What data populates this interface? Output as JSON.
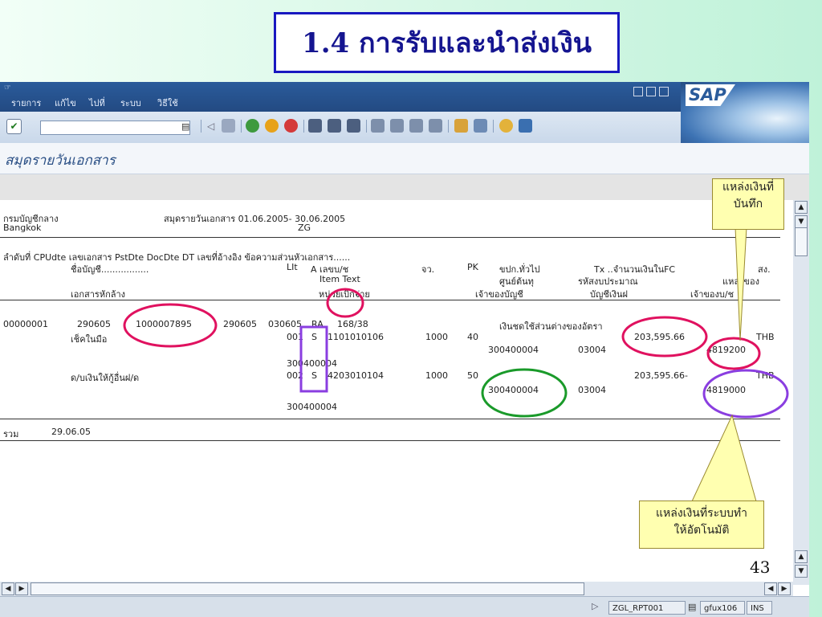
{
  "slide": {
    "title": "1.4 การรับและนำส่งเงิน",
    "page_number": "43"
  },
  "sap": {
    "menu": [
      "รายการ",
      "แก้ไข",
      "ไปที่",
      "ระบบ",
      "วิธีใช้"
    ],
    "logo_text": "SAP",
    "screen_title": "สมุดรายวันเอกสาร",
    "status": {
      "transaction": "ZGL_RPT001",
      "server": "gfux106",
      "mode": "INS"
    }
  },
  "report": {
    "org": "กรมบัญชีกลาง",
    "city": "Bangkok",
    "journal_title": "สมุดรายวันเอกสาร 01.06.2005- 30.06.2005",
    "zg": "ZG",
    "header_line1": "ลำดับที่ CPUdte เลขเอกสาร  PstDte DocDte DT เลขที่อ้างอิง   ข้อความส่วนหัวเอกสาร......",
    "header_line2a": "ชื่อบัญชี.................",
    "header_line2b": "LIt",
    "header_line2c": "A  เลขบ/ช",
    "header_line2d": "จว.",
    "header_line2e": "PK",
    "header_line2f": "ขปก.ทั่วไป",
    "header_line2g": "Tx  ..จำนวนเงินในFC",
    "header_line2h": "สง.",
    "header_item_text": "Item Text",
    "header_cost_center": "ศูนย์ต้นทุ",
    "header_budget_code": "รหัสงบประมาณ",
    "header_source": "แหล่งของ",
    "header_line3a": "เอกสารหักล้าง",
    "header_line3b": "หน่วยเบิกจ่าย",
    "header_line3c": "เจ้าของบัญชี",
    "header_line3d": "บัญชีเงินฝ",
    "header_line3e": "เจ้าของบ/ช",
    "doc": {
      "seq": "00000001",
      "cpudte": "290605",
      "doc_no": "1000007895",
      "pstdte": "290605",
      "docdte": "030605",
      "dt": "RA",
      "ref": "168/38",
      "header_text": "เงินชดใช้ส่วนต่างของอัตรา"
    },
    "lines": [
      {
        "account_name": "เช็คในมือ",
        "lit": "001",
        "a": "S",
        "account": "1101010106",
        "region": "1000",
        "pk": "40",
        "gl_owner": "300400004",
        "tx": "03004",
        "amount": "203,595.66",
        "currency": "THB",
        "fund_source": "4819200",
        "disb_unit": "300400004"
      },
      {
        "account_name": "ด/บเงินให้กู้อื่นฝ/ด",
        "lit": "002",
        "a": "S",
        "account": "4203010104",
        "region": "1000",
        "pk": "50",
        "gl_owner": "300400004",
        "tx": "03004",
        "amount": "203,595.66-",
        "currency": "THB",
        "fund_source": "4819000",
        "disb_unit": "300400004"
      }
    ],
    "total_label": "รวม",
    "total_date": "29.06.05"
  },
  "callouts": {
    "recorded_source": [
      "แหล่งเงินที่",
      "บันทึก"
    ],
    "auto_source": [
      "แหล่งเงินที่ระบบทำ",
      "ให้อัตโนมัติ"
    ]
  },
  "colors": {
    "sap_bar": "#2a5b9b",
    "annotation_red": "#e0115f",
    "annotation_green": "#1a9a2a",
    "annotation_purple": "#8a3ee0",
    "callout_fill": "#ffffb0"
  }
}
